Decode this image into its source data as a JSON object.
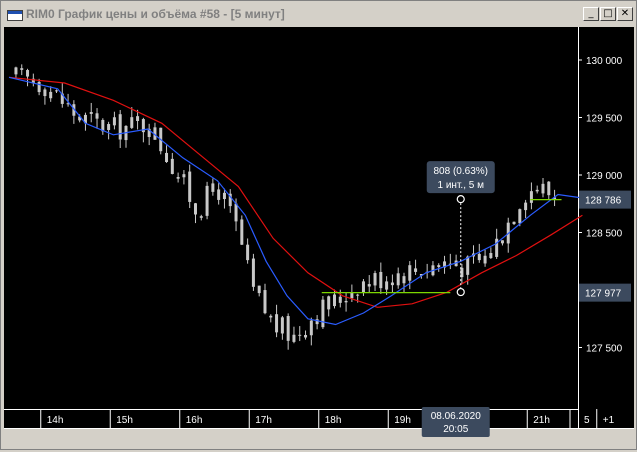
{
  "window": {
    "title": "RIM0 График цены и объёма #58 - [5 минут]",
    "buttons": {
      "minimize": "_",
      "maximize": "□",
      "close": "✕"
    },
    "icon": "chart-window-icon"
  },
  "colors": {
    "background": "#000000",
    "candle": "#c8c8c8",
    "ma_fast": "#2a5cff",
    "ma_slow": "#e01010",
    "level_line": "#7cd600",
    "label_bg": "#3c4a5e",
    "axis_text": "#ffffff"
  },
  "chart_data": {
    "type": "candlestick",
    "y_ticks": [
      "130 000",
      "129 500",
      "129 000",
      "128 500",
      "128 000",
      "127 500"
    ],
    "y_tick_values": [
      130000,
      129500,
      129000,
      128500,
      128000,
      127500
    ],
    "x_ticks": [
      "14h",
      "15h",
      "16h",
      "17h",
      "18h",
      "19h",
      "20h",
      "21h",
      "+1"
    ],
    "x_tick_hours": [
      14,
      15,
      16,
      17,
      18,
      19,
      20,
      21,
      22
    ],
    "zoom_label": "5",
    "ylim": [
      127250,
      130250
    ],
    "price_labels": [
      {
        "text": "128 786",
        "value": 128786
      },
      {
        "text": "127 977",
        "value": 127977
      }
    ],
    "measure_tooltip": {
      "line1": "808 (0.63%)",
      "line2": "1 инт., 5 м"
    },
    "cursor_time": {
      "line1": "08.06.2020",
      "line2": "20:05"
    },
    "levels": [
      {
        "value": 127977,
        "from_hour": 18.0,
        "to_hour": 19.85
      },
      {
        "value": 128786,
        "from_hour": 21.0,
        "to_hour": 21.45
      }
    ],
    "measure_points": [
      {
        "hour": 20.0,
        "value": 128790
      },
      {
        "hour": 20.0,
        "value": 127982
      }
    ],
    "anchor_points": [
      {
        "hour": 13.6,
        "value": 129850
      },
      {
        "hour": 14.0,
        "value": 129800
      },
      {
        "hour": 14.5,
        "value": 129500
      },
      {
        "hour": 15.0,
        "value": 129400
      },
      {
        "hour": 15.5,
        "value": 129450
      },
      {
        "hour": 15.8,
        "value": 129150
      },
      {
        "hour": 16.2,
        "value": 128700
      },
      {
        "hour": 16.5,
        "value": 128900
      },
      {
        "hour": 16.8,
        "value": 128500
      },
      {
        "hour": 17.0,
        "value": 128000
      },
      {
        "hour": 17.3,
        "value": 127700
      },
      {
        "hour": 17.6,
        "value": 127600
      },
      {
        "hour": 17.9,
        "value": 127800
      },
      {
        "hour": 18.2,
        "value": 127900
      },
      {
        "hour": 18.5,
        "value": 128050
      },
      {
        "hour": 18.8,
        "value": 128100
      },
      {
        "hour": 19.1,
        "value": 128150
      },
      {
        "hour": 19.5,
        "value": 128200
      },
      {
        "hour": 19.8,
        "value": 128250
      },
      {
        "hour": 20.1,
        "value": 128200
      },
      {
        "hour": 20.4,
        "value": 128300
      },
      {
        "hour": 20.6,
        "value": 128500
      },
      {
        "hour": 20.9,
        "value": 128850
      },
      {
        "hour": 21.1,
        "value": 128900
      },
      {
        "hour": 21.4,
        "value": 128800
      }
    ],
    "ma_slow_points": [
      {
        "hour": 13.5,
        "value": 129850
      },
      {
        "hour": 14.3,
        "value": 129800
      },
      {
        "hour": 15.0,
        "value": 129650
      },
      {
        "hour": 15.7,
        "value": 129450
      },
      {
        "hour": 16.3,
        "value": 129150
      },
      {
        "hour": 16.8,
        "value": 128900
      },
      {
        "hour": 17.3,
        "value": 128450
      },
      {
        "hour": 17.8,
        "value": 128150
      },
      {
        "hour": 18.3,
        "value": 127950
      },
      {
        "hour": 18.8,
        "value": 127850
      },
      {
        "hour": 19.3,
        "value": 127880
      },
      {
        "hour": 19.8,
        "value": 127980
      },
      {
        "hour": 20.3,
        "value": 128150
      },
      {
        "hour": 20.8,
        "value": 128300
      },
      {
        "hour": 21.3,
        "value": 128480
      },
      {
        "hour": 21.75,
        "value": 128650
      }
    ],
    "ma_fast_points": [
      {
        "hour": 13.5,
        "value": 129850
      },
      {
        "hour": 14.2,
        "value": 129750
      },
      {
        "hour": 14.6,
        "value": 129450
      },
      {
        "hour": 15.0,
        "value": 129350
      },
      {
        "hour": 15.5,
        "value": 129400
      },
      {
        "hour": 16.0,
        "value": 129150
      },
      {
        "hour": 16.5,
        "value": 128950
      },
      {
        "hour": 16.9,
        "value": 128650
      },
      {
        "hour": 17.2,
        "value": 128250
      },
      {
        "hour": 17.5,
        "value": 127950
      },
      {
        "hour": 17.8,
        "value": 127750
      },
      {
        "hour": 18.2,
        "value": 127700
      },
      {
        "hour": 18.6,
        "value": 127800
      },
      {
        "hour": 19.0,
        "value": 127950
      },
      {
        "hour": 19.5,
        "value": 128150
      },
      {
        "hour": 20.0,
        "value": 128250
      },
      {
        "hour": 20.5,
        "value": 128400
      },
      {
        "hour": 21.0,
        "value": 128650
      },
      {
        "hour": 21.4,
        "value": 128830
      },
      {
        "hour": 21.75,
        "value": 128800
      }
    ]
  }
}
